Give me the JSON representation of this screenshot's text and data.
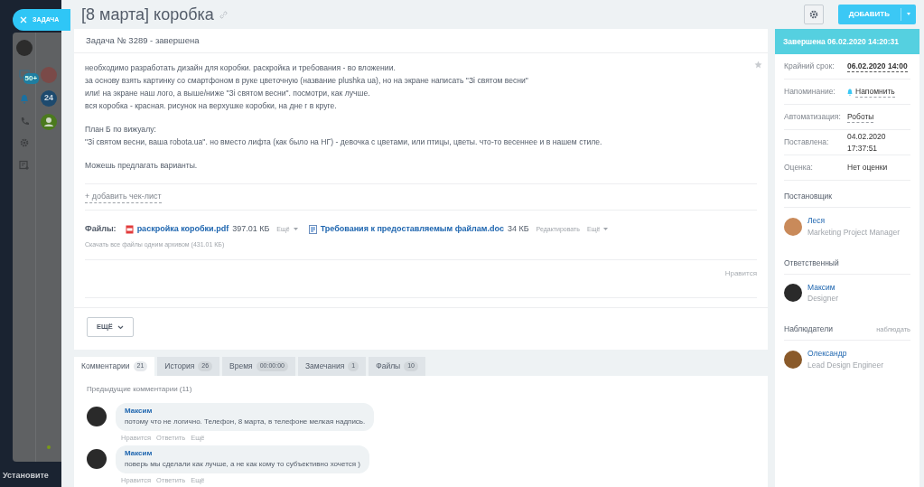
{
  "left_bar": {
    "close_tab": "ЗАДАЧА",
    "counter_badge": "50+",
    "chat_badge": "24",
    "footer_text": "Установите"
  },
  "header": {
    "title": "[8 марта] коробка",
    "add_button": "ДОБАВИТЬ"
  },
  "task": {
    "heading": "Задача № 3289 - завершена",
    "starred": false,
    "description": [
      [
        "необходимо разработать дизайн для коробки. раскройка и требования - во вложении.",
        "за основу взять картинку со смартфоном в руке цветочную (название plushka ua), но на экране написать \"Зі святом весни\"",
        "или! на экране наш лого, а выше/ниже \"Зі святом весни\". посмотри, как лучше.",
        "вся коробка - красная. рисунок на верхушке коробки, на дне  г в круге."
      ],
      [
        "План Б по вижуалу:",
        "\"Зі святом весни, ваша robota.ua\". но вместо лифта (как было на НГ) - девочка с цветами, или птицы, цветы. что-то весеннее и в нашем стиле."
      ],
      [
        "Можешь предлагать варианты."
      ]
    ],
    "checklist_link": "+ добавить чек-лист",
    "files_label": "Файлы:",
    "files": [
      {
        "kind": "pdf",
        "name": "раскройка коробки.pdf",
        "size": "397.01 КБ",
        "actions": [
          "Ещё"
        ]
      },
      {
        "kind": "doc",
        "name": "Требования к предоставляемым файлам.doc",
        "size": "34 КБ",
        "actions": [
          "Редактировать",
          "Ещё"
        ]
      }
    ],
    "download_all": "Скачать все файлы одним архивом (431.01 КБ)",
    "like": "Нравится",
    "more_button": "ЕЩЁ"
  },
  "sidebar": {
    "status": "Завершена 06.02.2020 14:20:31",
    "fields": [
      {
        "label": "Крайний срок:",
        "value": "06.02.2020 14:00",
        "kind": "strong-link"
      },
      {
        "label": "Напоминание:",
        "value": "Напомнить",
        "kind": "bell-link"
      },
      {
        "label": "Автоматизация:",
        "value": "Роботы",
        "kind": "link"
      },
      {
        "label": "Поставлена:",
        "value": "04.02.2020 17:37:51",
        "kind": "plain"
      },
      {
        "label": "Оценка:",
        "value": "Нет оценки",
        "kind": "plain"
      }
    ],
    "roles": [
      {
        "title": "Постановщик",
        "person": {
          "name": "Леся",
          "role": "Marketing Project Manager"
        }
      },
      {
        "title": "Ответственный",
        "person": {
          "name": "Максим",
          "role": "Designer"
        }
      },
      {
        "title": "Наблюдатели",
        "action": "наблюдать",
        "person": {
          "name": "Олександр",
          "role": "Lead Design Engineer"
        }
      }
    ]
  },
  "tabs": [
    {
      "label": "Комментарии",
      "count": "21",
      "selected": true
    },
    {
      "label": "История",
      "count": "26",
      "selected": false
    },
    {
      "label": "Время",
      "count": "00:00:00",
      "selected": false
    },
    {
      "label": "Замечания",
      "count": "1",
      "selected": false
    },
    {
      "label": "Файлы",
      "count": "10",
      "selected": false
    }
  ],
  "comments": {
    "previous": "Предыдущие комментарии",
    "previous_count": "(11)",
    "items": [
      {
        "author": "Максим",
        "text": "потому что не логично. Телефон, 8 марта, в телефоне мелкая надпись.",
        "actions": [
          "Нравится",
          "Ответить",
          "Ещё"
        ]
      },
      {
        "author": "Максим",
        "text": "поверь мы сделали как лучше, а не как кому то субъективно хочется )",
        "actions": [
          "Нравится",
          "Ответить",
          "Ещё"
        ]
      }
    ]
  }
}
